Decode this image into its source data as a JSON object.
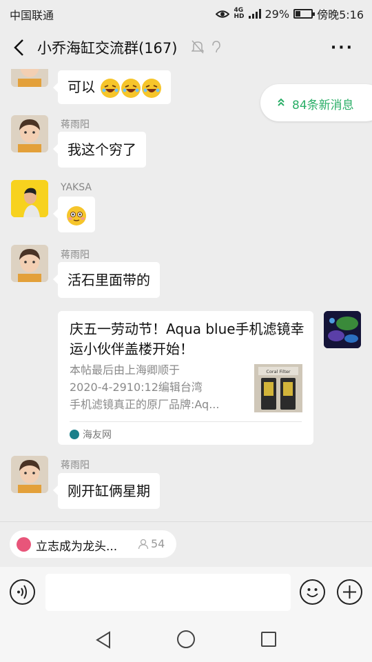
{
  "status": {
    "carrier": "中国联通",
    "network_top": "4G",
    "network_bottom": "HD",
    "battery_percent_text": "29%",
    "battery_level": 0.29,
    "time": "傍晚5:16"
  },
  "header": {
    "title": "小乔海缸交流群(167)",
    "mute_icon": "bell-off-icon",
    "ear_icon": "earpiece-icon",
    "more_label": "···"
  },
  "new_messages": {
    "label": "84条新消息"
  },
  "messages": [
    {
      "sender": "",
      "text": "可以",
      "emoji": "rofl-emoji"
    },
    {
      "sender": "蒋雨阳",
      "text": "我这个穷了"
    },
    {
      "sender": "YAKSA",
      "text": "",
      "emoji": "flushed-emoji"
    },
    {
      "sender": "蒋雨阳",
      "text": "活石里面带的"
    },
    {
      "sender": "",
      "card": {
        "title": "庆五一劳动节！Aqua blue手机滤镜幸运小伙伴盖楼开始！",
        "desc_lines": [
          "本帖最后由上海卿顺于",
          "2020-4-2910:12编辑台湾",
          "手机滤镜真正的原厂品牌:Aq..."
        ],
        "thumb_label": "Coral Filter",
        "source": "海友网"
      }
    },
    {
      "sender": "蒋雨阳",
      "text": "刚开缸俩星期"
    }
  ],
  "mini_program": {
    "name": "立志成为龙头...",
    "count": "54"
  },
  "input": {
    "placeholder": ""
  },
  "colors": {
    "accent_green": "#2aae67",
    "background": "#ededed",
    "bubble": "#ffffff"
  }
}
